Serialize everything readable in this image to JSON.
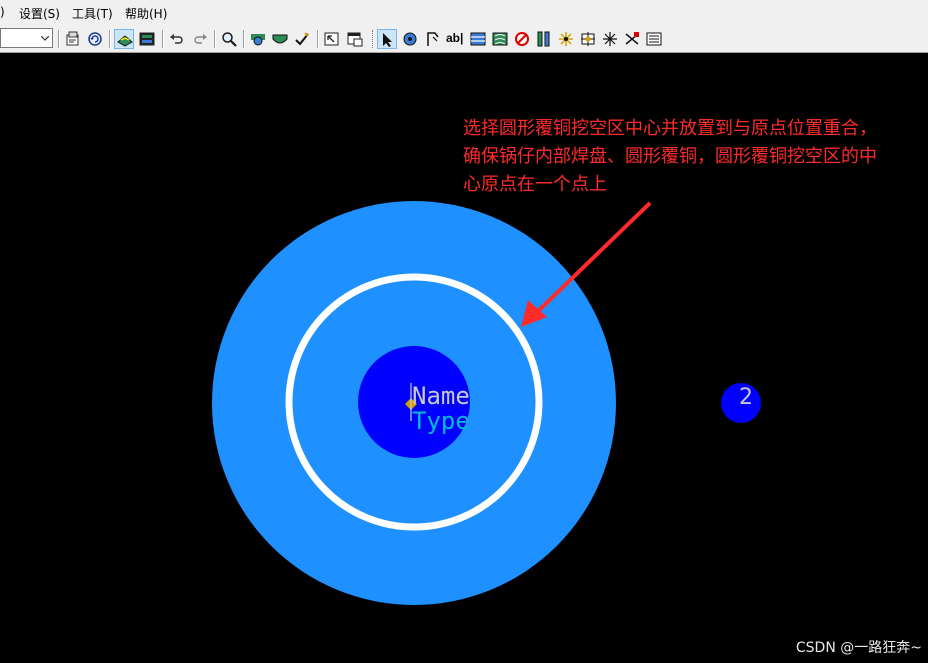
{
  "menubar": {
    "items": [
      {
        "label": ")"
      },
      {
        "label": "设置(S)"
      },
      {
        "label": "工具(T)"
      },
      {
        "label": "帮助(H)"
      }
    ]
  },
  "toolbar": {
    "combo_value": "",
    "text_tool_label": "ab|"
  },
  "canvas": {
    "background": "#000000",
    "outer_copper_color": "#1e90ff",
    "clearance_ring_color": "#ffffff",
    "pad_color": "#0000ff",
    "pad_name_label": "Name",
    "pad_type_label": "Type",
    "pad_name_color": "#c8c8c8",
    "pad_type_color": "#00bcd4",
    "pin_2_label": "2",
    "annotation": "选择圆形覆铜挖空区中心并放置到与原点位置重合，确保锅仔内部焊盘、圆形覆铜，圆形覆铜挖空区的中心原点在一个点上",
    "annotation_color": "#ff2a2a"
  },
  "watermark": "CSDN @一路狂奔~"
}
